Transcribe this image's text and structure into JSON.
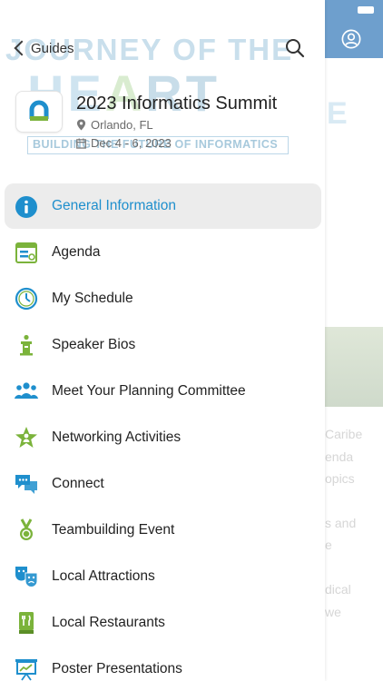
{
  "nav": {
    "back_label": "Guides"
  },
  "event": {
    "title": "2023 Informatics Summit",
    "location": "Orlando, FL",
    "dates": "Dec 4 - 6, 2023"
  },
  "watermark": {
    "line1": "JOURNEY OF THE",
    "line2": "HEART",
    "tagline": "BUILDING THE FUTURE OF INFORMATICS"
  },
  "menu": {
    "items": [
      {
        "label": "General Information",
        "icon": "info-icon",
        "active": true
      },
      {
        "label": "Agenda",
        "icon": "agenda-icon"
      },
      {
        "label": "My Schedule",
        "icon": "clock-icon"
      },
      {
        "label": "Speaker Bios",
        "icon": "podium-icon"
      },
      {
        "label": "Meet Your Planning Committee",
        "icon": "group-icon"
      },
      {
        "label": "Networking Activities",
        "icon": "star-person-icon"
      },
      {
        "label": "Connect",
        "icon": "chat-icon"
      },
      {
        "label": "Teambuilding Event",
        "icon": "medal-icon"
      },
      {
        "label": "Local Attractions",
        "icon": "theater-masks-icon"
      },
      {
        "label": "Local Restaurants",
        "icon": "restaurant-icon"
      },
      {
        "label": "Poster Presentations",
        "icon": "easel-icon"
      }
    ]
  },
  "background": {
    "letter": "E",
    "lines": [
      "Caribe",
      "enda",
      "opics",
      "s and",
      "e",
      "dical",
      "we"
    ]
  },
  "colors": {
    "accent": "#1f8fcd",
    "header_blue": "#6e9fcd",
    "icon_green": "#7bb33b",
    "icon_blue": "#1f8fcd"
  }
}
